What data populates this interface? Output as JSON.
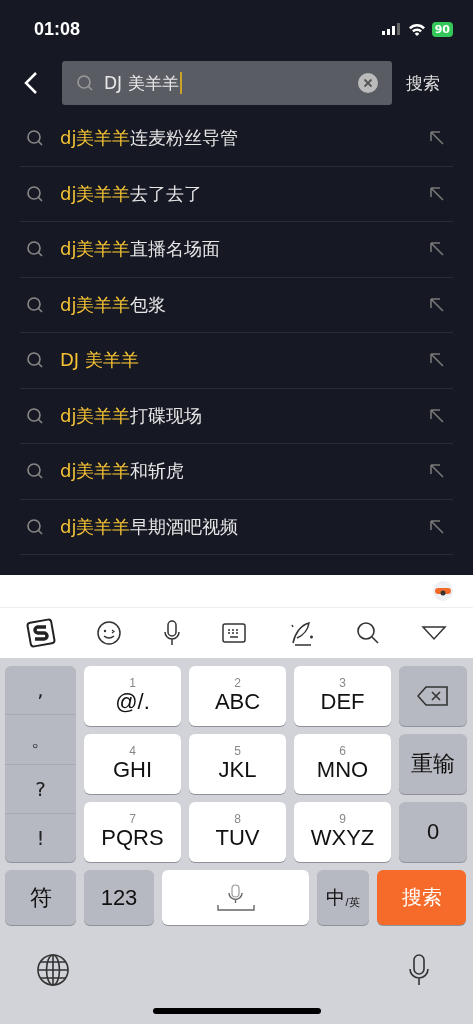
{
  "status_bar": {
    "time": "01:08",
    "battery": "90"
  },
  "search_bar": {
    "value": "DJ 美羊羊",
    "button": "搜索"
  },
  "suggestions": [
    {
      "match": "dj美羊羊",
      "rest": "连麦粉丝导管"
    },
    {
      "match": "dj美羊羊",
      "rest": "去了去了"
    },
    {
      "match": "dj美羊羊",
      "rest": "直播名场面"
    },
    {
      "match": "dj美羊羊",
      "rest": "包浆"
    },
    {
      "match": "DJ 美羊羊"
    },
    {
      "match": "dj美羊羊",
      "rest": "打碟现场"
    },
    {
      "match": "dj美羊羊",
      "rest": "和斩虎"
    },
    {
      "match": "dj美羊羊",
      "rest": "早期酒吧视频"
    }
  ],
  "keyboard": {
    "punctuation": [
      ",",
      "。",
      "?",
      "!"
    ],
    "keys": [
      {
        "digit": "1",
        "letters": "@/."
      },
      {
        "digit": "2",
        "letters": "ABC"
      },
      {
        "digit": "3",
        "letters": "DEF"
      },
      {
        "digit": "4",
        "letters": "GHI"
      },
      {
        "digit": "5",
        "letters": "JKL"
      },
      {
        "digit": "6",
        "letters": "MNO"
      },
      {
        "digit": "7",
        "letters": "PQRS"
      },
      {
        "digit": "8",
        "letters": "TUV"
      },
      {
        "digit": "9",
        "letters": "WXYZ"
      }
    ],
    "retype": "重输",
    "zero": "0",
    "symbols": "符",
    "numbers": "123",
    "lang_main": "中",
    "lang_sub": "/英",
    "action": "搜索"
  }
}
